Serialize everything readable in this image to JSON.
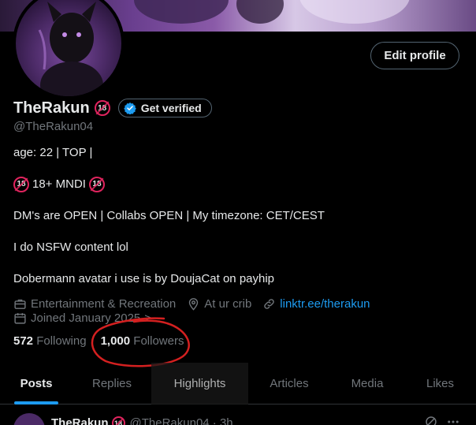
{
  "profile": {
    "display_name": "TheRakun",
    "badge_18": "18",
    "verify_label": "Get verified",
    "handle": "@TheRakun04",
    "edit_label": "Edit profile"
  },
  "bio": {
    "line1": "age: 22 | TOP |",
    "line2": "18+ MNDI",
    "line3": "DM's are OPEN | Collabs OPEN | My timezone: CET/CEST",
    "line4": "I do NSFW content lol",
    "line5": "Dobermann avatar i use is by DoujaCat on payhip"
  },
  "meta": {
    "category": "Entertainment & Recreation",
    "location": "At ur crib",
    "link": "linktr.ee/therakun",
    "joined": "Joined January 2025",
    "joined_chevron": ">"
  },
  "follow": {
    "following_count": "572",
    "following_label": "Following",
    "followers_count": "1,000",
    "followers_label": "Followers"
  },
  "tabs": [
    "Posts",
    "Replies",
    "Highlights",
    "Articles",
    "Media",
    "Likes"
  ],
  "post": {
    "name": "TheRakun",
    "handle": "@TheRakun04 · 3h"
  },
  "colors": {
    "accent": "#1d9bf0",
    "annotation": "#d42020",
    "muted_text": "#71767b"
  },
  "icons": [
    "verified-check-icon",
    "briefcase-icon",
    "location-pin-icon",
    "link-icon",
    "calendar-icon",
    "grok-icon",
    "more-icon"
  ]
}
